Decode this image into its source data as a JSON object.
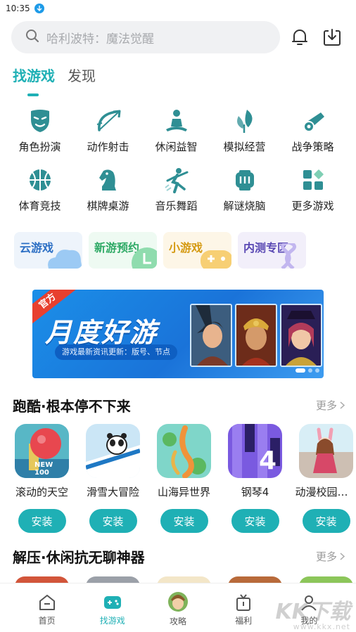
{
  "status_bar": {
    "time": "10:35"
  },
  "search": {
    "placeholder": "哈利波特：魔法觉醒"
  },
  "tabs": [
    {
      "label": "找游戏",
      "active": true
    },
    {
      "label": "发现",
      "active": false
    }
  ],
  "categories": [
    {
      "label": "角色扮演",
      "icon": "mask-icon"
    },
    {
      "label": "动作射击",
      "icon": "bow-icon"
    },
    {
      "label": "休闲益智",
      "icon": "meditation-icon"
    },
    {
      "label": "模拟经营",
      "icon": "leaf-icon"
    },
    {
      "label": "战争策略",
      "icon": "cannon-icon"
    },
    {
      "label": "体育竞技",
      "icon": "basketball-icon"
    },
    {
      "label": "棋牌桌游",
      "icon": "chess-knight-icon"
    },
    {
      "label": "音乐舞蹈",
      "icon": "dancer-icon"
    },
    {
      "label": "解谜烧脑",
      "icon": "puzzle-icon"
    },
    {
      "label": "更多游戏",
      "icon": "grid-icon"
    }
  ],
  "quick_entries": [
    {
      "label": "云游戏"
    },
    {
      "label": "新游预约"
    },
    {
      "label": "小游戏"
    },
    {
      "label": "内测专区"
    }
  ],
  "banner": {
    "badge": "官方",
    "headline": "月度好游",
    "subtitle": "游戏最新资讯更新：版号、节点"
  },
  "section1": {
    "title": "跑酷·根本停不下来",
    "more": "更多",
    "games": [
      {
        "name": "滚动的天空",
        "badge": "NEW 100",
        "install": "安装"
      },
      {
        "name": "滑雪大冒险",
        "install": "安装"
      },
      {
        "name": "山海异世界",
        "install": "安装"
      },
      {
        "name": "钢琴4",
        "badge": "4",
        "install": "安装"
      },
      {
        "name": "动漫校园模拟器",
        "install": "安装"
      }
    ]
  },
  "section2": {
    "title": "解压·休闲抗无聊神器",
    "more": "更多"
  },
  "bottom_nav": [
    {
      "label": "首页",
      "active": false
    },
    {
      "label": "找游戏",
      "active": true
    },
    {
      "label": "攻略",
      "active": false
    },
    {
      "label": "福利",
      "active": false
    },
    {
      "label": "我的",
      "active": false
    }
  ],
  "watermark": {
    "text": "KK下载",
    "url": "www.kkx.net"
  },
  "colors": {
    "accent": "#1fb0b5",
    "icon": "#2f8f94"
  }
}
